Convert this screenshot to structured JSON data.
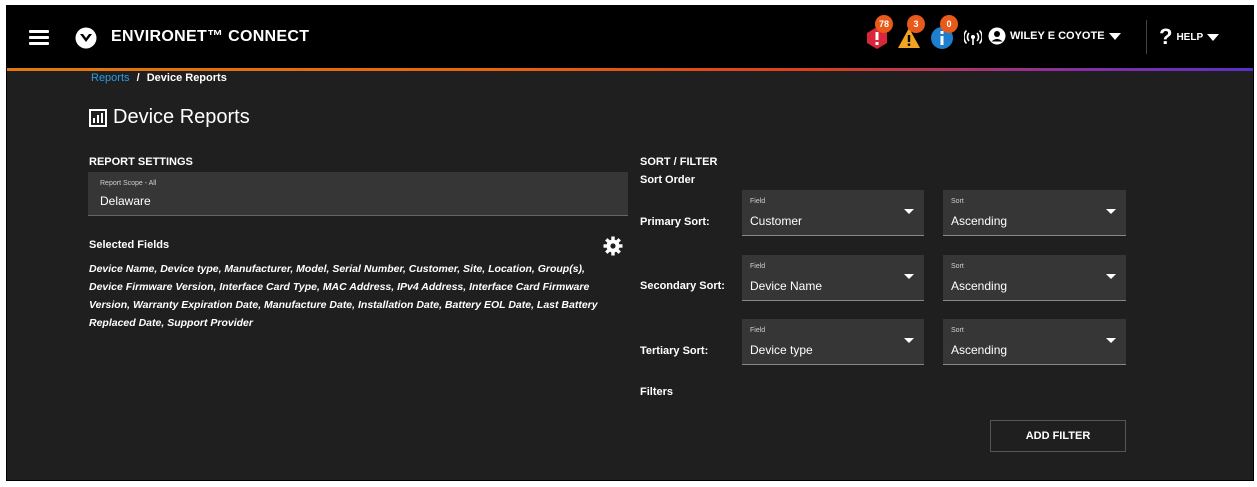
{
  "header": {
    "app_title": "ENVIRONET™ CONNECT",
    "alerts": {
      "critical": "78",
      "warning": "3",
      "info": "0"
    },
    "user_name": "WILEY E COYOTE",
    "help_label": "HELP"
  },
  "breadcrumb": {
    "parent": "Reports",
    "separator": "/",
    "current": "Device Reports"
  },
  "page_title": "Device Reports",
  "report_settings": {
    "heading": "REPORT SETTINGS",
    "scope_label": "Report Scope - All",
    "scope_value": "Delaware",
    "selected_fields_label": "Selected Fields",
    "selected_fields_text": "Device Name, Device type, Manufacturer, Model, Serial Number, Customer, Site, Location, Group(s), Device Firmware Version, Interface Card Type, MAC Address, IPv4 Address, Interface Card Firmware Version, Warranty Expiration Date, Manufacture Date, Installation Date, Battery EOL Date, Last Battery Replaced Date, Support Provider"
  },
  "sort_filter": {
    "heading": "SORT / FILTER",
    "sort_order_label": "Sort Order",
    "rows": [
      {
        "label": "Primary Sort:",
        "field_label": "Field",
        "field_value": "Customer",
        "sort_label": "Sort",
        "sort_value": "Ascending"
      },
      {
        "label": "Secondary Sort:",
        "field_label": "Field",
        "field_value": "Device Name",
        "sort_label": "Sort",
        "sort_value": "Ascending"
      },
      {
        "label": "Tertiary Sort:",
        "field_label": "Field",
        "field_value": "Device type",
        "sort_label": "Sort",
        "sort_value": "Ascending"
      }
    ],
    "filters_label": "Filters",
    "add_filter_label": "ADD FILTER"
  },
  "colors": {
    "background": "#1f1f1f",
    "link": "#2b9be6",
    "badge": "#e8591a",
    "critical": "#d8263a",
    "warning": "#f0a422",
    "info": "#1e7fd0"
  }
}
